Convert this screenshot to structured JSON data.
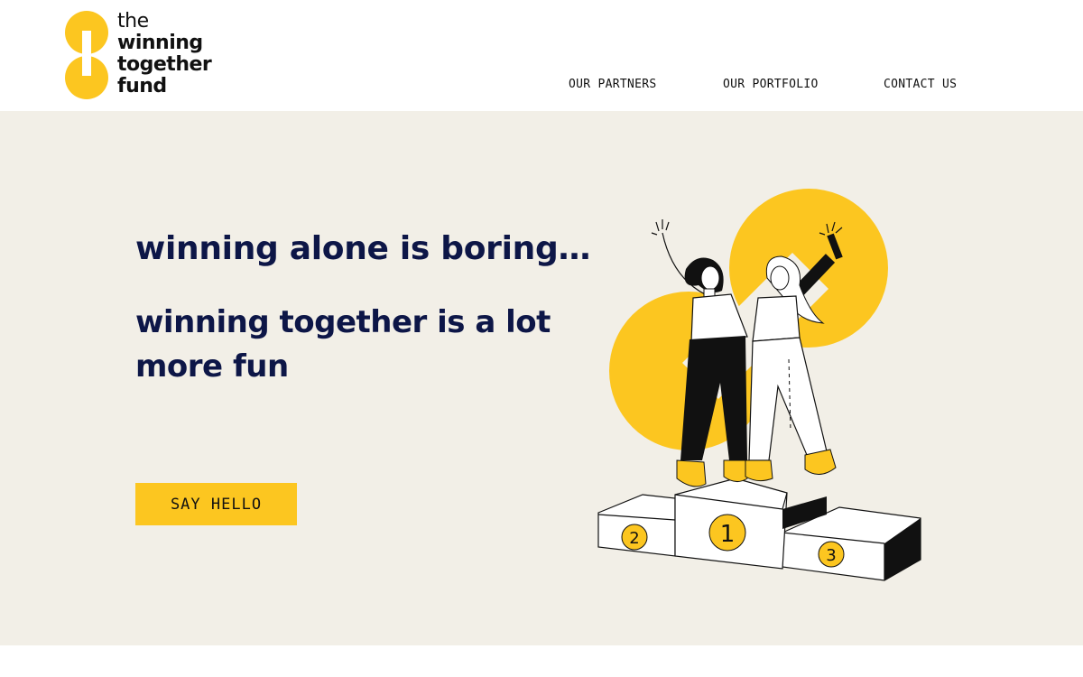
{
  "brand": {
    "logo_lines": [
      "the",
      "winning",
      "together",
      "fund"
    ],
    "accent_color": "#fcc620",
    "navy_color": "#0d1647",
    "hero_background": "#f2efe7"
  },
  "nav": {
    "items": [
      "OUR PARTNERS",
      "OUR PORTFOLIO",
      "CONTACT US"
    ]
  },
  "hero": {
    "tagline_light": "winning alone is boring…",
    "tagline_bold": "winning together is a lot more fun",
    "cta_label": "SAY HELLO"
  },
  "illustration": {
    "podium_places": [
      "2",
      "1",
      "3"
    ]
  }
}
